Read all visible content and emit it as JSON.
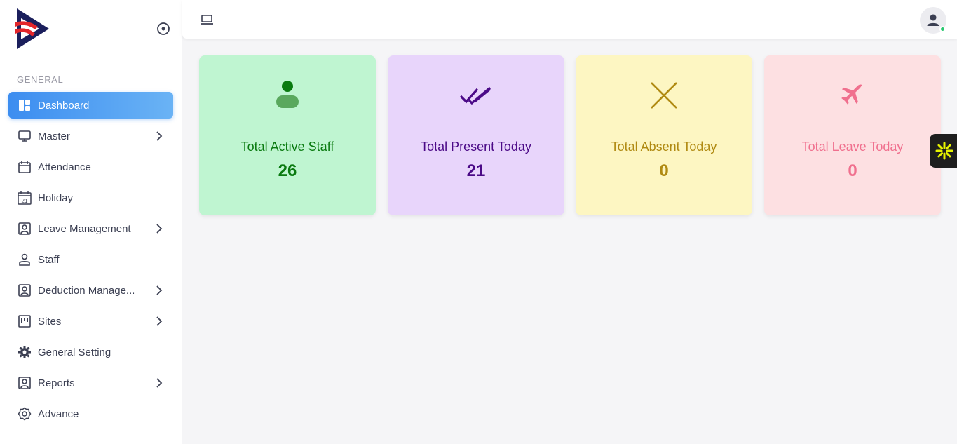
{
  "sidebar": {
    "section_label": "GENERAL",
    "items": [
      {
        "label": "Dashboard",
        "icon": "dashboard-icon",
        "active": true,
        "has_submenu": false
      },
      {
        "label": "Master",
        "icon": "monitor-icon",
        "has_submenu": true
      },
      {
        "label": "Attendance",
        "icon": "calendar-icon",
        "has_submenu": false
      },
      {
        "label": "Holiday",
        "icon": "calendar-date-icon",
        "has_submenu": false
      },
      {
        "label": "Leave Management",
        "icon": "user-badge-icon",
        "has_submenu": true
      },
      {
        "label": "Staff",
        "icon": "person-icon",
        "has_submenu": false
      },
      {
        "label": "Deduction Manage...",
        "icon": "user-badge-icon",
        "has_submenu": true
      },
      {
        "label": "Sites",
        "icon": "board-icon",
        "has_submenu": true
      },
      {
        "label": "General Setting",
        "icon": "gear-icon",
        "has_submenu": false
      },
      {
        "label": "Reports",
        "icon": "user-badge-icon",
        "has_submenu": true
      },
      {
        "label": "Advance",
        "icon": "settings-badge-icon",
        "has_submenu": false
      }
    ],
    "holiday_icon_text": "21"
  },
  "cards": [
    {
      "title": "Total Active Staff",
      "value": "26",
      "icon": "person-icon"
    },
    {
      "title": "Total Present Today",
      "value": "21",
      "icon": "double-check-icon"
    },
    {
      "title": "Total Absent Today",
      "value": "0",
      "icon": "cross-icon"
    },
    {
      "title": "Total Leave Today",
      "value": "0",
      "icon": "airplane-icon"
    }
  ],
  "colors": {
    "accent": "#3c8df0",
    "staff": "#0a7a10",
    "present": "#4b0a87",
    "absent": "#b08a12",
    "leave": "#f0708e",
    "online": "#28c76f"
  }
}
